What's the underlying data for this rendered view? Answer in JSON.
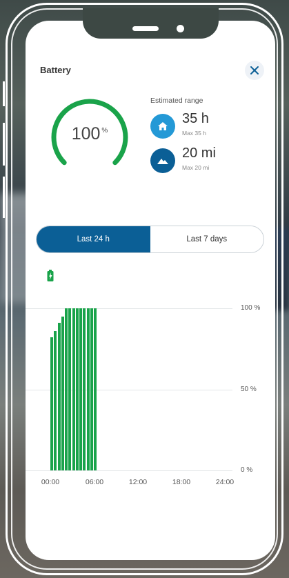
{
  "header": {
    "title": "Battery"
  },
  "icons": {
    "close": "close-icon",
    "home": "home-icon",
    "mountain": "mountain-icon",
    "battery": "battery-charging-icon"
  },
  "colors": {
    "gauge": "#1aa34a",
    "active_tab": "#0b5f96",
    "home_icon_bg": "#2499d6",
    "mountain_icon_bg": "#0b5f96",
    "bars": "#19a34a"
  },
  "battery": {
    "level": "100",
    "unit": "%"
  },
  "range": {
    "label": "Estimated range",
    "items": [
      {
        "value": "35 h",
        "max": "Max 35 h"
      },
      {
        "value": "20 mi",
        "max": "Max 20 mi"
      }
    ]
  },
  "tabs": [
    {
      "label": "Last 24 h",
      "active": true
    },
    {
      "label": "Last 7 days",
      "active": false
    }
  ],
  "chart_data": {
    "type": "bar",
    "x_ticks": [
      "00:00",
      "06:00",
      "12:00",
      "18:00",
      "24:00"
    ],
    "y_ticks": [
      "100 %",
      "50 %",
      "0 %"
    ],
    "ylim": [
      0,
      100
    ],
    "xlim": [
      0,
      24
    ],
    "x": [
      0.0,
      0.5,
      1.0,
      1.5,
      2.0,
      2.5,
      3.0,
      3.5,
      4.0,
      4.5,
      5.0,
      5.5,
      6.0
    ],
    "values": [
      82,
      86,
      91,
      95,
      100,
      100,
      100,
      100,
      100,
      100,
      100,
      100,
      100
    ]
  }
}
